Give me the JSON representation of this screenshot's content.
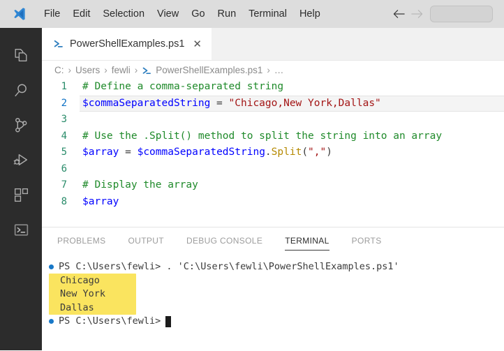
{
  "titlebar": {
    "logo_icon": "vscode-logo",
    "menus": [
      {
        "label": "File"
      },
      {
        "label": "Edit"
      },
      {
        "label": "Selection"
      },
      {
        "label": "View"
      },
      {
        "label": "Go"
      },
      {
        "label": "Run"
      },
      {
        "label": "Terminal"
      },
      {
        "label": "Help"
      }
    ],
    "back_icon": "arrow-left-icon",
    "forward_icon": "arrow-right-icon",
    "search_value": "",
    "search_placeholder": ""
  },
  "activitybar": {
    "items": [
      {
        "icon": "explorer-files-icon",
        "name": "explorer"
      },
      {
        "icon": "search-icon",
        "name": "search"
      },
      {
        "icon": "source-control-branch-icon",
        "name": "source-control"
      },
      {
        "icon": "run-and-debug-icon",
        "name": "run-and-debug"
      },
      {
        "icon": "extensions-blocks-icon",
        "name": "extensions"
      },
      {
        "icon": "terminal-console-icon",
        "name": "terminal"
      }
    ]
  },
  "tab": {
    "icon": "powershell-file-icon",
    "label": "PowerShellExamples.ps1",
    "close_label": "✕"
  },
  "breadcrumbs": {
    "separator": "›",
    "items": [
      {
        "label": "C:",
        "icon": ""
      },
      {
        "label": "Users",
        "icon": ""
      },
      {
        "label": "fewli",
        "icon": ""
      },
      {
        "label": "PowerShellExamples.ps1",
        "icon": "powershell-file-icon"
      },
      {
        "label": "…",
        "icon": ""
      }
    ]
  },
  "editor": {
    "lines": [
      {
        "number": "1",
        "active": false,
        "tokens": [
          {
            "text": "# Define a comma-separated string",
            "cls": "c-com"
          }
        ]
      },
      {
        "number": "2",
        "active": true,
        "tokens": [
          {
            "text": "$commaSeparatedString",
            "cls": "c-var"
          },
          {
            "text": " = ",
            "cls": "c-op"
          },
          {
            "text": "\"Chicago,New York,Dallas\"",
            "cls": "c-str"
          }
        ]
      },
      {
        "number": "3",
        "active": false,
        "tokens": [
          {
            "text": "",
            "cls": "c-plain"
          }
        ]
      },
      {
        "number": "4",
        "active": false,
        "tokens": [
          {
            "text": "# Use the .Split() method to split the string into an array",
            "cls": "c-com"
          }
        ]
      },
      {
        "number": "5",
        "active": false,
        "tokens": [
          {
            "text": "$array",
            "cls": "c-var"
          },
          {
            "text": " = ",
            "cls": "c-op"
          },
          {
            "text": "$commaSeparatedString",
            "cls": "c-var"
          },
          {
            "text": ".",
            "cls": "c-op"
          },
          {
            "text": "Split",
            "cls": "c-fn"
          },
          {
            "text": "(",
            "cls": "c-op"
          },
          {
            "text": "\",\"",
            "cls": "c-str"
          },
          {
            "text": ")",
            "cls": "c-op"
          }
        ]
      },
      {
        "number": "6",
        "active": false,
        "tokens": [
          {
            "text": "",
            "cls": "c-plain"
          }
        ]
      },
      {
        "number": "7",
        "active": false,
        "tokens": [
          {
            "text": "# Display the array",
            "cls": "c-com"
          }
        ]
      },
      {
        "number": "8",
        "active": false,
        "tokens": [
          {
            "text": "$array",
            "cls": "c-var"
          }
        ]
      }
    ]
  },
  "panel": {
    "tabs": [
      {
        "label": "PROBLEMS",
        "active": false
      },
      {
        "label": "OUTPUT",
        "active": false
      },
      {
        "label": "DEBUG CONSOLE",
        "active": false
      },
      {
        "label": "TERMINAL",
        "active": true
      },
      {
        "label": "PORTS",
        "active": false
      }
    ],
    "terminal": {
      "prompt_command": "PS C:\\Users\\fewli> . 'C:\\Users\\fewli\\PowerShellExamples.ps1'",
      "output_lines": [
        "Chicago",
        "New York",
        "Dallas"
      ],
      "prompt_final": "PS C:\\Users\\fewli>",
      "highlight_color": "#fae45f",
      "bullet_color": "#1878c8"
    }
  }
}
